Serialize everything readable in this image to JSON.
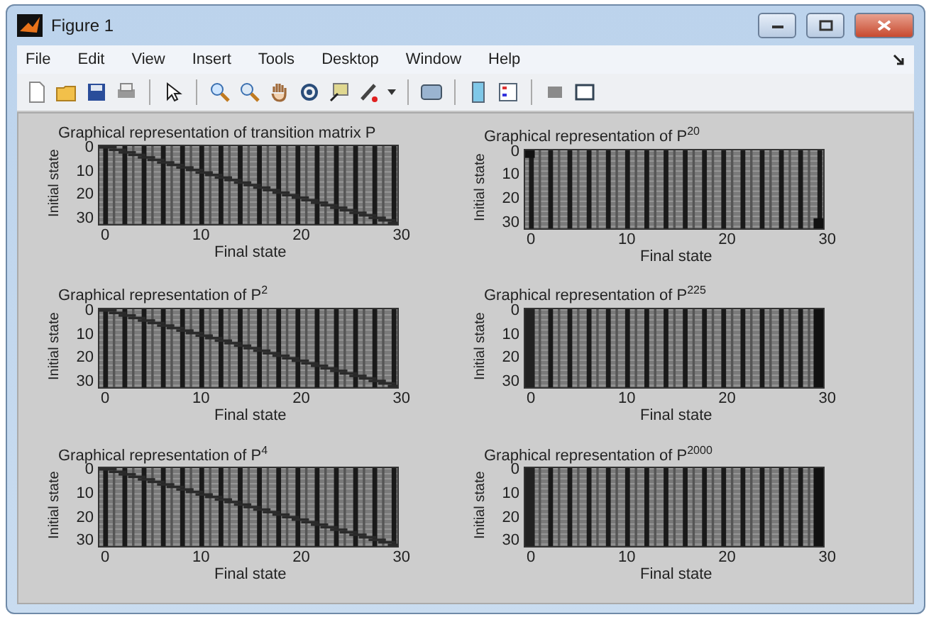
{
  "window": {
    "title": "Figure 1"
  },
  "menu": [
    "File",
    "Edit",
    "View",
    "Insert",
    "Tools",
    "Desktop",
    "Window",
    "Help"
  ],
  "plots": [
    {
      "title": "Graphical representation of transition matrix P",
      "kind": "diagonal",
      "ylabel": "Initial state",
      "yticks": [
        "0",
        "10",
        "20",
        "30"
      ],
      "xticks": [
        "0",
        "10",
        "20",
        "30"
      ],
      "xlabel": "Final state"
    },
    {
      "title": "Graphical representation of P$^{20}$",
      "kind": "corners",
      "ylabel": "Initial state",
      "yticks": [
        "0",
        "10",
        "20",
        "30"
      ],
      "xticks": [
        "0",
        "10",
        "20",
        "30"
      ],
      "xlabel": "Final state"
    },
    {
      "title": "Graphical representation of P$^{2}$",
      "kind": "diagonal",
      "ylabel": "Initial state",
      "yticks": [
        "0",
        "10",
        "20",
        "30"
      ],
      "xticks": [
        "0",
        "10",
        "20",
        "30"
      ],
      "xlabel": "Final state"
    },
    {
      "title": "Graphical representation of P$^{225}$",
      "kind": "columns",
      "ylabel": "Initial state",
      "yticks": [
        "0",
        "10",
        "20",
        "30"
      ],
      "xticks": [
        "0",
        "10",
        "20",
        "30"
      ],
      "xlabel": "Final state"
    },
    {
      "title": "Graphical representation of P$^{4}$",
      "kind": "diagonal",
      "ylabel": "Initial state",
      "yticks": [
        "0",
        "10",
        "20",
        "30"
      ],
      "xticks": [
        "0",
        "10",
        "20",
        "30"
      ],
      "xlabel": "Final state"
    },
    {
      "title": "Graphical representation of P$^{2000}$",
      "kind": "columns",
      "ylabel": "Initial state",
      "yticks": [
        "0",
        "10",
        "20",
        "30"
      ],
      "xticks": [
        "0",
        "10",
        "20",
        "30"
      ],
      "xlabel": "Final state"
    }
  ]
}
